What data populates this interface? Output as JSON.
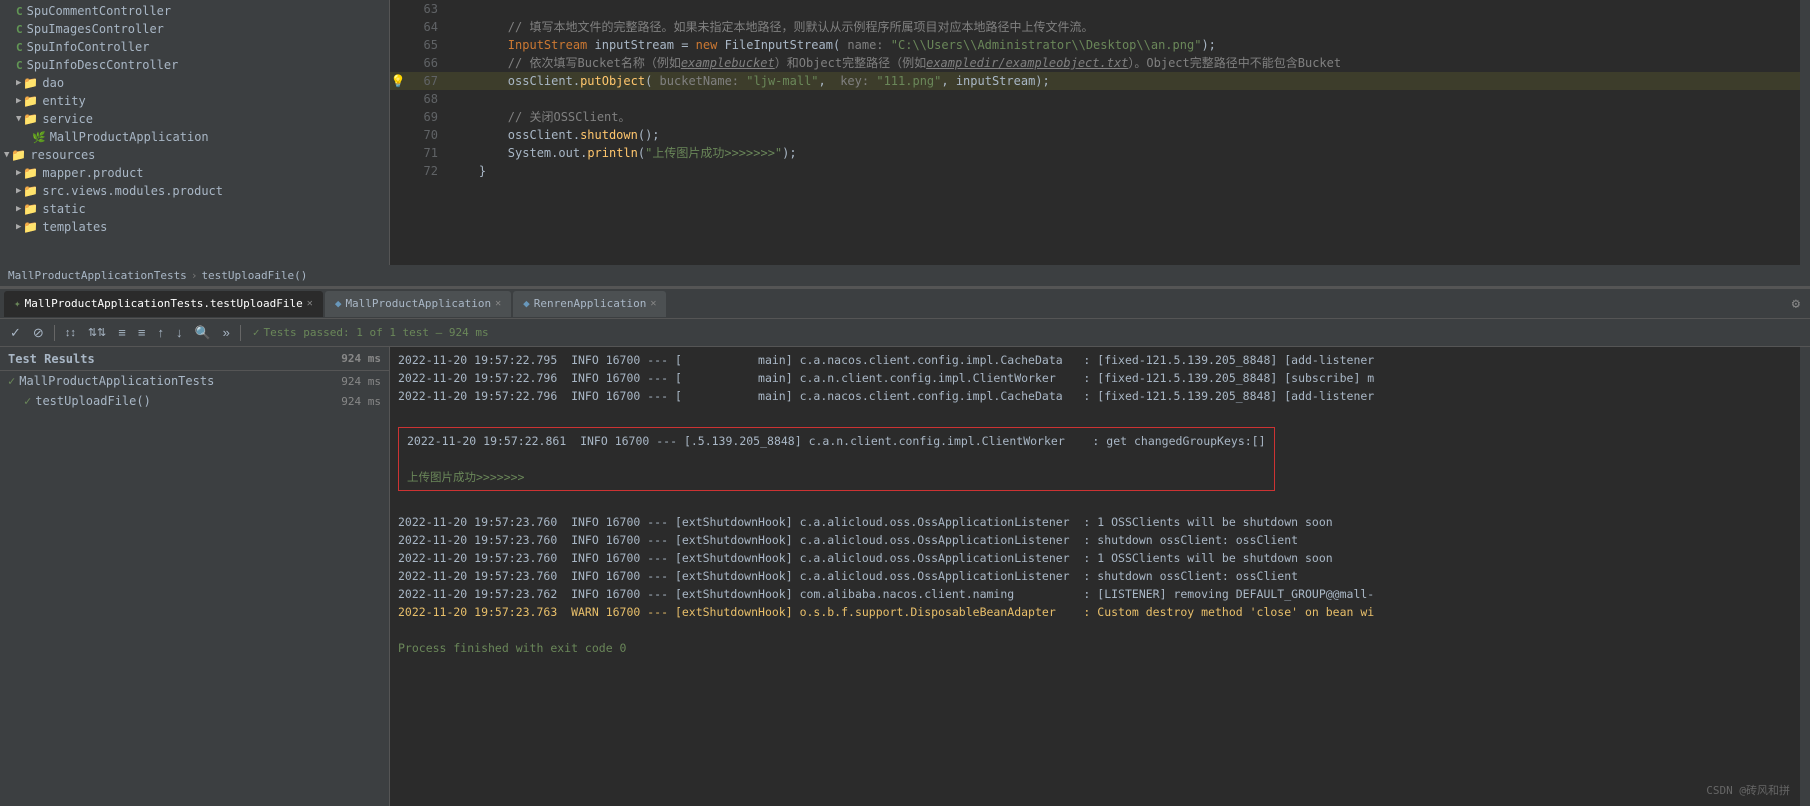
{
  "fileTree": {
    "items": [
      {
        "id": "spucomment",
        "label": "SpuCommentController",
        "type": "class",
        "indent": 1
      },
      {
        "id": "spuimages",
        "label": "SpuImagesController",
        "type": "class",
        "indent": 1
      },
      {
        "id": "spuinfo",
        "label": "SpuInfoController",
        "type": "class",
        "indent": 1
      },
      {
        "id": "spuinfodesc",
        "label": "SpuInfoDescController",
        "type": "class",
        "indent": 1
      },
      {
        "id": "dao",
        "label": "dao",
        "type": "folder",
        "indent": 1,
        "collapsed": true
      },
      {
        "id": "entity",
        "label": "entity",
        "type": "folder",
        "indent": 1,
        "collapsed": true
      },
      {
        "id": "service",
        "label": "service",
        "type": "folder",
        "indent": 1,
        "collapsed": false
      },
      {
        "id": "mallproductapp",
        "label": "MallProductApplication",
        "type": "class-special",
        "indent": 2
      },
      {
        "id": "resources",
        "label": "resources",
        "type": "folder",
        "indent": 0,
        "collapsed": false
      },
      {
        "id": "mapper",
        "label": "mapper.product",
        "type": "folder",
        "indent": 1,
        "collapsed": true
      },
      {
        "id": "srcviews",
        "label": "src.views.modules.product",
        "type": "folder",
        "indent": 1,
        "collapsed": true
      },
      {
        "id": "static",
        "label": "static",
        "type": "folder",
        "indent": 1,
        "collapsed": true
      },
      {
        "id": "templates",
        "label": "templates",
        "type": "folder",
        "indent": 1,
        "collapsed": true
      }
    ]
  },
  "codeLines": [
    {
      "num": 63,
      "content": "",
      "highlight": false
    },
    {
      "num": 64,
      "content": "        // 填写本地文件的完整路径。如果未指定本地路径，则默认从示例程序所属项目对应本地路径中上传文件流。",
      "highlight": false,
      "type": "comment"
    },
    {
      "num": 65,
      "content": "        InputStream inputStream = new FileInputStream( name: \"C:\\\\Users\\\\Administrator\\\\Desktop\\\\an.png\");",
      "highlight": false
    },
    {
      "num": 66,
      "content": "        // 依次填写Bucket名称（例如examplebucket）和Object完整路径（例如exampledir/exampleobject.txt）。Object完整路径中不能包含Bucket",
      "highlight": false,
      "type": "comment"
    },
    {
      "num": 67,
      "content": "        ossClient.putObject( bucketName: \"ljw-mall\",  key: \"111.png\", inputStream);",
      "highlight": true,
      "hasBulb": true
    },
    {
      "num": 68,
      "content": "",
      "highlight": false
    },
    {
      "num": 69,
      "content": "        // 关闭OSSClient。",
      "highlight": false,
      "type": "comment"
    },
    {
      "num": 70,
      "content": "        ossClient.shutdown();",
      "highlight": false
    },
    {
      "num": 71,
      "content": "        System.out.println(\"上传图片成功>>>>>>>\");",
      "highlight": false
    },
    {
      "num": 72,
      "content": "    }",
      "highlight": false
    }
  ],
  "breadcrumb": {
    "parts": [
      "MallProductApplicationTests",
      ">",
      "testUploadFile()"
    ]
  },
  "tabs": {
    "editor": [
      {
        "label": "MallProductApplicationTests.testUploadFile",
        "active": true,
        "type": "test"
      },
      {
        "label": "MallProductApplication",
        "active": false,
        "type": "app"
      },
      {
        "label": "RenrenApplication",
        "active": false,
        "type": "app"
      }
    ],
    "gear": "⚙"
  },
  "toolbar": {
    "buttons": [
      "✓",
      "⊘",
      "↕↕",
      "↕↕",
      "≡",
      "≡",
      "↑",
      "↓",
      "🔍",
      "»"
    ],
    "status": "Tests passed: 1 of 1 test – 924 ms"
  },
  "testResults": {
    "header": "Test Results",
    "duration": "924 ms",
    "items": [
      {
        "label": "MallProductApplicationTests",
        "duration": "924 ms",
        "indent": 0
      },
      {
        "label": "testUploadFile()",
        "duration": "924 ms",
        "indent": 1
      }
    ]
  },
  "logLines": [
    {
      "text": "2022-11-20 19:57:22.795  INFO 16700 --- [           main] c.a.nacos.client.config.impl.CacheData   : [fixed-121.5.139.205_8848] [add-listener",
      "type": "info"
    },
    {
      "text": "2022-11-20 19:57:22.796  INFO 16700 --- [           main] c.a.n.client.config.impl.ClientWorker    : [fixed-121.5.139.205_8848] [subscribe] m",
      "type": "info"
    },
    {
      "text": "2022-11-20 19:57:22.796  INFO 16700 --- [           main] c.a.nacos.client.config.impl.CacheData   : [fixed-121.5.139.205_8848] [add-listener",
      "type": "info"
    },
    {
      "text": "",
      "type": "spacer"
    },
    {
      "text": "2022-11-20 19:57:22.861  INFO 16700 --- [.5.139.205_8848] c.a.n.client.config.impl.ClientWorker    : get changedGroupKeys:[]",
      "type": "highlighted"
    },
    {
      "text": "上传图片成功>>>>>>>",
      "type": "highlighted-success"
    },
    {
      "text": "",
      "type": "spacer"
    },
    {
      "text": "2022-11-20 19:57:23.760  INFO 16700 --- [extShutdownHook] c.a.alicloud.oss.OssApplicationListener  : 1 OSSClients will be shutdown soon",
      "type": "info"
    },
    {
      "text": "2022-11-20 19:57:23.760  INFO 16700 --- [extShutdownHook] c.a.alicloud.oss.OssApplicationListener  : shutdown ossClient: ossClient",
      "type": "info"
    },
    {
      "text": "2022-11-20 19:57:23.760  INFO 16700 --- [extShutdownHook] c.a.alicloud.oss.OssApplicationListener  : 1 OSSClients will be shutdown soon",
      "type": "info"
    },
    {
      "text": "2022-11-20 19:57:23.760  INFO 16700 --- [extShutdownHook] c.a.alicloud.oss.OssApplicationListener  : shutdown ossClient: ossClient",
      "type": "info"
    },
    {
      "text": "2022-11-20 19:57:23.762  INFO 16700 --- [extShutdownHook] com.alibaba.nacos.client.naming          : [LISTENER] removing DEFAULT_GROUP@@mall-",
      "type": "info"
    },
    {
      "text": "2022-11-20 19:57:23.763  WARN 16700 --- [extShutdownHook] o.s.b.f.support.DisposableBeanAdapter    : Custom destroy method 'close' on bean wi",
      "type": "warn"
    },
    {
      "text": "",
      "type": "spacer"
    },
    {
      "text": "Process finished with exit code 0",
      "type": "success"
    }
  ],
  "watermark": "CSDN @砖风和拼"
}
